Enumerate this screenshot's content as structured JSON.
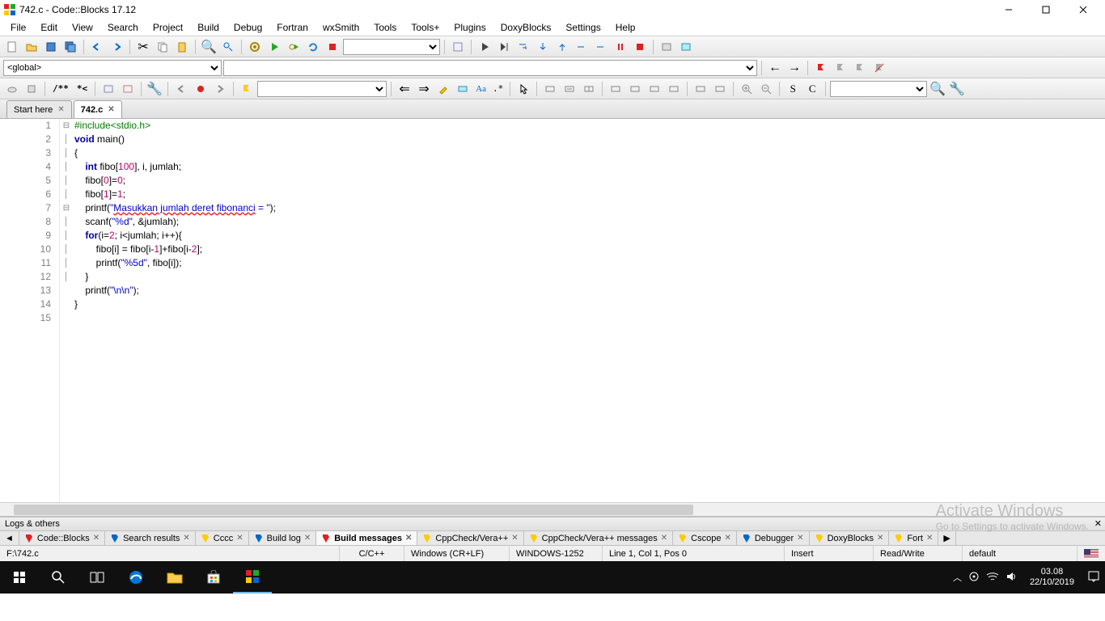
{
  "window": {
    "title": "742.c - Code::Blocks 17.12"
  },
  "menu": [
    "File",
    "Edit",
    "View",
    "Search",
    "Project",
    "Build",
    "Debug",
    "Fortran",
    "wxSmith",
    "Tools",
    "Tools+",
    "Plugins",
    "DoxyBlocks",
    "Settings",
    "Help"
  ],
  "scope_combo": "<global>",
  "tabs": [
    {
      "label": "Start here",
      "active": false
    },
    {
      "label": "742.c",
      "active": true
    }
  ],
  "code": {
    "lines": 15,
    "tokens": [
      [
        {
          "t": "#include",
          "c": "pp"
        },
        {
          "t": "<stdio.h>",
          "c": "pp"
        }
      ],
      [
        {
          "t": "void ",
          "c": "kw"
        },
        {
          "t": "main",
          "c": ""
        },
        {
          "t": "()",
          "c": ""
        }
      ],
      [
        {
          "t": "{",
          "c": ""
        }
      ],
      [
        {
          "t": "    ",
          "c": ""
        },
        {
          "t": "int ",
          "c": "kw"
        },
        {
          "t": "fibo[",
          "c": ""
        },
        {
          "t": "100",
          "c": "num"
        },
        {
          "t": "], i, jumlah;",
          "c": ""
        }
      ],
      [
        {
          "t": "    fibo[",
          "c": ""
        },
        {
          "t": "0",
          "c": "num"
        },
        {
          "t": "]=",
          "c": ""
        },
        {
          "t": "0",
          "c": "num"
        },
        {
          "t": ";",
          "c": ""
        }
      ],
      [
        {
          "t": "    fibo[",
          "c": ""
        },
        {
          "t": "1",
          "c": "num"
        },
        {
          "t": "]=",
          "c": ""
        },
        {
          "t": "1",
          "c": "num"
        },
        {
          "t": ";",
          "c": ""
        }
      ],
      [
        {
          "t": "    printf(",
          "c": ""
        },
        {
          "t": "\"",
          "c": "str"
        },
        {
          "t": "Masukkan jumlah deret fibonanci",
          "c": "str err"
        },
        {
          "t": " = \"",
          "c": "str"
        },
        {
          "t": ");",
          "c": ""
        }
      ],
      [
        {
          "t": "    scanf(",
          "c": ""
        },
        {
          "t": "\"%d\"",
          "c": "str"
        },
        {
          "t": ", &jumlah);",
          "c": ""
        }
      ],
      [
        {
          "t": "    ",
          "c": ""
        },
        {
          "t": "for",
          "c": "kw"
        },
        {
          "t": "(i=",
          "c": ""
        },
        {
          "t": "2",
          "c": "num"
        },
        {
          "t": "; i<jumlah; i++){",
          "c": ""
        }
      ],
      [
        {
          "t": "        fibo[i] = fibo[i-",
          "c": ""
        },
        {
          "t": "1",
          "c": "num"
        },
        {
          "t": "]+fibo[i-",
          "c": ""
        },
        {
          "t": "2",
          "c": "num"
        },
        {
          "t": "];",
          "c": ""
        }
      ],
      [
        {
          "t": "        printf(",
          "c": ""
        },
        {
          "t": "\"%5d\"",
          "c": "str"
        },
        {
          "t": ", fibo[i]);",
          "c": ""
        }
      ],
      [
        {
          "t": "    }",
          "c": ""
        }
      ],
      [
        {
          "t": "    printf(",
          "c": ""
        },
        {
          "t": "\"\\n\\n\"",
          "c": "str"
        },
        {
          "t": ");",
          "c": ""
        }
      ],
      [
        {
          "t": "}",
          "c": ""
        }
      ],
      [
        {
          "t": "",
          "c": ""
        }
      ]
    ],
    "fold": {
      "3": "⊟",
      "9": "⊟"
    }
  },
  "logs": {
    "title": "Logs & others",
    "tabs": [
      "Code::Blocks",
      "Search results",
      "Cccc",
      "Build log",
      "Build messages",
      "CppCheck/Vera++",
      "CppCheck/Vera++ messages",
      "Cscope",
      "Debugger",
      "DoxyBlocks",
      "Fort"
    ],
    "active": 4
  },
  "status": {
    "path": "F:\\742.c",
    "lang": "C/C++",
    "eol": "Windows (CR+LF)",
    "enc": "WINDOWS-1252",
    "pos": "Line 1, Col 1, Pos 0",
    "ins": "Insert",
    "rw": "Read/Write",
    "profile": "default"
  },
  "watermark": {
    "t1": "Activate Windows",
    "t2": "Go to Settings to activate Windows."
  },
  "taskbar": {
    "time": "03.08",
    "date": "22/10/2019"
  }
}
